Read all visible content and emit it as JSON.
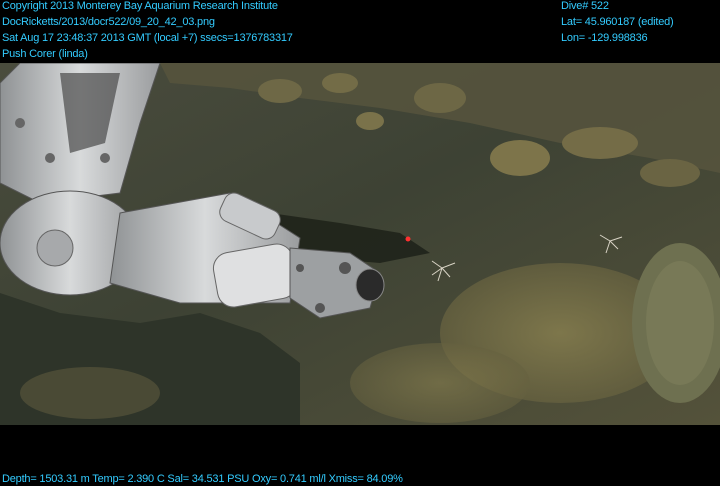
{
  "header_left": {
    "copyright": "Copyright 2013 Monterey Bay Aquarium Research Institute",
    "file_path": "DocRicketts/2013/docr522/09_20_42_03.png",
    "datetime": "Sat Aug 17 23:48:37 2013 GMT (local +7)  ssecs=1376783317",
    "tool": "Push Corer (linda)"
  },
  "header_right": {
    "dive": "Dive# 522",
    "lat": "Lat= 45.960187 (edited)",
    "lon": "Lon= -129.998836"
  },
  "footer": {
    "telemetry": "Depth= 1503.31 m  Temp= 2.390 C  Sal= 34.531 PSU  Oxy= 0.741 ml/l  Xmiss= 84.09%"
  },
  "colors": {
    "overlay_text": "#33ccff",
    "letterbox": "#000000",
    "seafloor": "#3b4136",
    "sediment": "#6f6a46",
    "manipulator": "#b7b9bb"
  }
}
